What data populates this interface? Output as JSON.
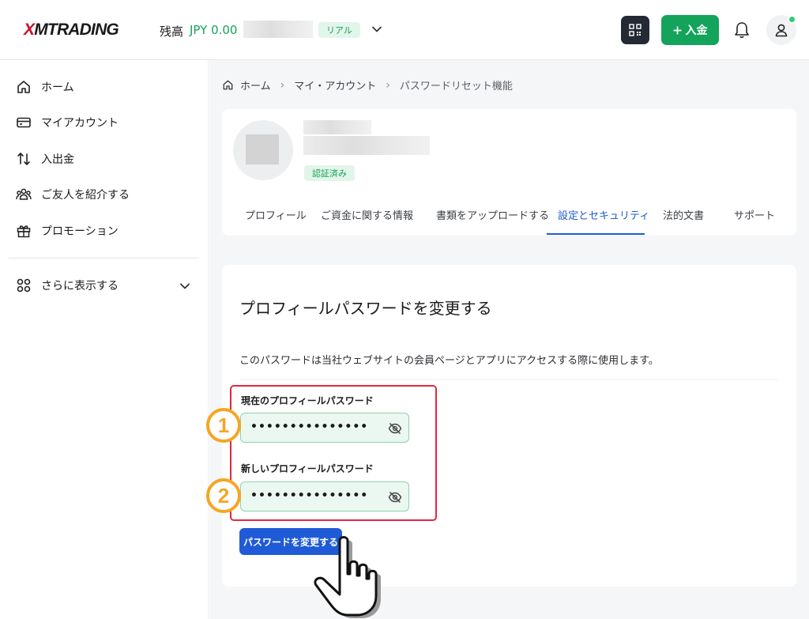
{
  "header": {
    "logo": {
      "mark": "X",
      "rest": "MTRADING"
    },
    "balance_label": "残高",
    "balance_value": "JPY 0.00",
    "account_type_badge": "リアル",
    "deposit_button": "入金",
    "colors": {
      "brand_green": "#13a35a",
      "primary_blue": "#1f5bd7",
      "logo_red": "#c8102e"
    }
  },
  "sidebar": {
    "items": [
      {
        "label": "ホーム",
        "icon": "home-icon"
      },
      {
        "label": "マイアカウント",
        "icon": "wallet-icon"
      },
      {
        "label": "入出金",
        "icon": "transfer-icon"
      },
      {
        "label": "ご友人を紹介する",
        "icon": "people-icon"
      },
      {
        "label": "プロモーション",
        "icon": "gift-icon"
      }
    ],
    "more_label": "さらに表示する"
  },
  "breadcrumb": [
    "ホーム",
    "マイ・アカウント",
    "パスワードリセット機能"
  ],
  "profile": {
    "verified_badge": "認証済み",
    "tabs": [
      {
        "label": "プロフィール",
        "active": false
      },
      {
        "label": "ご資金に関する情報",
        "active": false
      },
      {
        "label": "書類をアップロードする",
        "active": false
      },
      {
        "label": "設定とセキュリティ",
        "active": true
      },
      {
        "label": "法的文書",
        "active": false
      },
      {
        "label": "サポート",
        "active": false
      }
    ]
  },
  "form": {
    "title": "プロフィールパスワードを変更する",
    "description": "このパスワードは当社ウェブサイトの会員ページとアプリにアクセスする際に使用します。",
    "current_password_label": "現在のプロフィールパスワード",
    "current_password_value": "•••••••••••••••",
    "new_password_label": "新しいプロフィールパスワード",
    "new_password_value": "•••••••••••••••",
    "submit_button": "パスワードを変更する",
    "step_badges": [
      "1",
      "2"
    ]
  }
}
